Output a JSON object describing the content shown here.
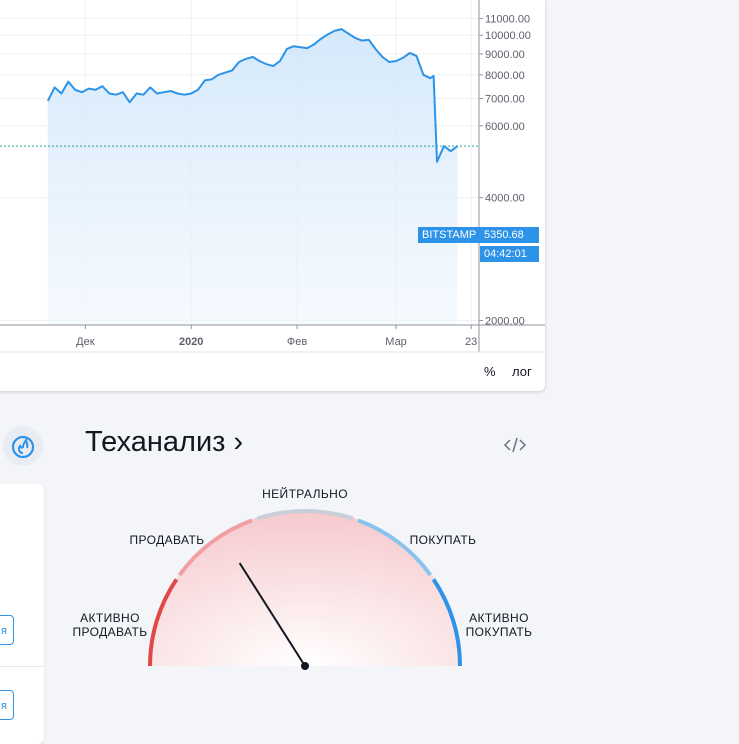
{
  "chart": {
    "exchange_label": "BITSTAMP",
    "last_price": "5350.68",
    "countdown": "04:42:01",
    "y_ticks": [
      "11000.00",
      "10000.00",
      "9000.00",
      "8000.00",
      "7000.00",
      "6000.00",
      "4000.00",
      "2000.00"
    ],
    "x_ticks": [
      "Дек",
      "2020",
      "Фев",
      "Мар",
      "23"
    ],
    "percent_toggle": "%",
    "log_toggle": "лог",
    "line_color": "#2c93e8",
    "fill_color": "#d6eaf8"
  },
  "chart_data": {
    "type": "area",
    "series": [
      {
        "x": [
          "2019-11-20",
          "2019-11-22",
          "2019-11-24",
          "2019-11-26",
          "2019-11-28",
          "2019-11-30",
          "2019-12-02",
          "2019-12-04",
          "2019-12-06",
          "2019-12-08",
          "2019-12-10",
          "2019-12-12",
          "2019-12-14",
          "2019-12-16",
          "2019-12-18",
          "2019-12-20",
          "2019-12-22",
          "2019-12-24",
          "2019-12-26",
          "2019-12-28",
          "2019-12-30",
          "2020-01-01",
          "2020-01-03",
          "2020-01-05",
          "2020-01-07",
          "2020-01-09",
          "2020-01-11",
          "2020-01-13",
          "2020-01-15",
          "2020-01-17",
          "2020-01-19",
          "2020-01-21",
          "2020-01-23",
          "2020-01-25",
          "2020-01-27",
          "2020-01-29",
          "2020-01-31",
          "2020-02-02",
          "2020-02-04",
          "2020-02-06",
          "2020-02-08",
          "2020-02-10",
          "2020-02-12",
          "2020-02-14",
          "2020-02-16",
          "2020-02-18",
          "2020-02-20",
          "2020-02-22",
          "2020-02-24",
          "2020-02-26",
          "2020-02-28",
          "2020-03-01",
          "2020-03-03",
          "2020-03-05",
          "2020-03-07",
          "2020-03-09",
          "2020-03-11",
          "2020-03-12",
          "2020-03-13",
          "2020-03-15",
          "2020-03-17",
          "2020-03-19"
        ],
        "values": [
          6900,
          7450,
          7200,
          7700,
          7350,
          7250,
          7400,
          7350,
          7500,
          7200,
          7150,
          7250,
          6850,
          7200,
          7150,
          7450,
          7200,
          7250,
          7300,
          7200,
          7150,
          7200,
          7350,
          7750,
          7800,
          8000,
          8100,
          8200,
          8600,
          8750,
          8850,
          8650,
          8500,
          8400,
          8650,
          9250,
          9400,
          9350,
          9300,
          9500,
          9800,
          10050,
          10250,
          10350,
          10100,
          9850,
          9700,
          9750,
          9250,
          8850,
          8600,
          8650,
          8800,
          9050,
          8900,
          8000,
          7850,
          7950,
          4900,
          5350,
          5200,
          5350
        ]
      }
    ],
    "ylim": [
      2000,
      11000
    ],
    "log_scale": true,
    "grid": true,
    "reference_line": 5350.68
  },
  "gauge": {
    "title": "Теханализ",
    "title_arrow": "›",
    "labels": {
      "strong_sell": [
        "АКТИВНО",
        "ПРОДАВАТЬ"
      ],
      "sell": "ПРОДАВАТЬ",
      "neutral": "НЕЙТРАЛЬНО",
      "buy": "ПОКУПАТЬ",
      "strong_buy": [
        "АКТИВНО",
        "ПОКУПАТЬ"
      ]
    },
    "needle_value": 0.32,
    "colors": {
      "strong_sell": "#e04848",
      "sell": "#f0a0a2",
      "neutral": "#c9cfd9",
      "buy": "#8ac3ee",
      "strong_buy": "#2c93e8"
    }
  },
  "side": {
    "chip_text": "я"
  }
}
